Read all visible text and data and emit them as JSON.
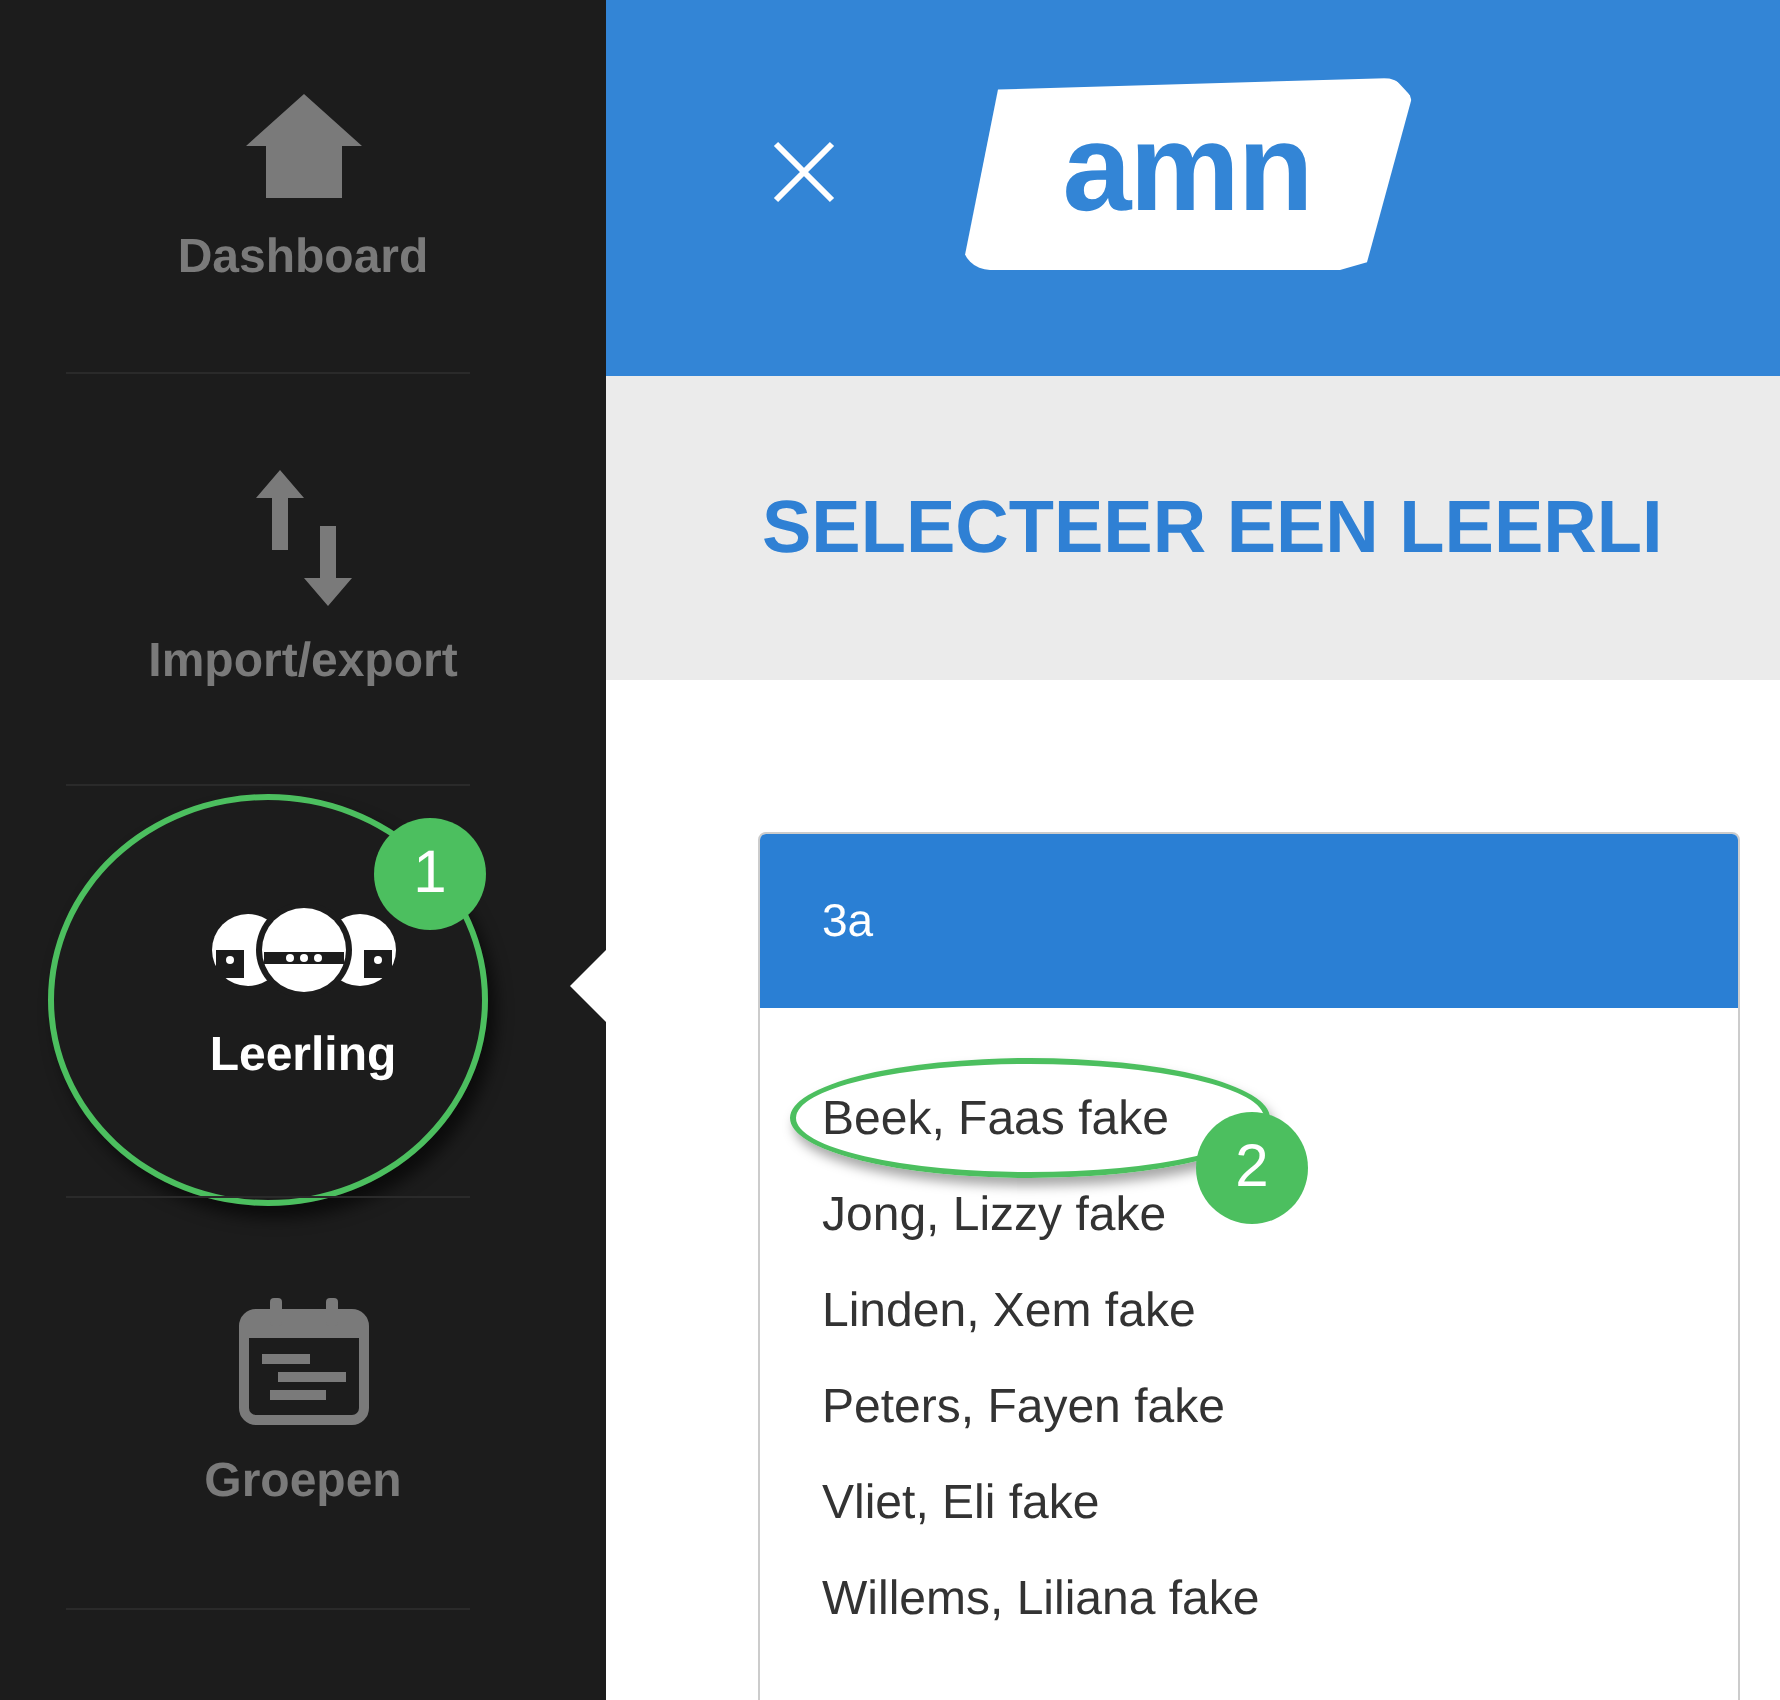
{
  "sidebar": {
    "items": [
      {
        "label": "Dashboard",
        "selected": false
      },
      {
        "label": "Import/export",
        "selected": false
      },
      {
        "label": "Leerling",
        "selected": true,
        "callout": "1"
      },
      {
        "label": "Groepen",
        "selected": false
      }
    ]
  },
  "header": {
    "logo": "amn"
  },
  "page_title": "SELECTEER EEN LEERLI",
  "group": {
    "title": "3a",
    "students": [
      {
        "name": "Beek, Faas fake",
        "callout": "2"
      },
      {
        "name": "Jong, Lizzy fake"
      },
      {
        "name": "Linden, Xem fake"
      },
      {
        "name": "Peters, Fayen fake"
      },
      {
        "name": "Vliet, Eli fake"
      },
      {
        "name": "Willems, Liliana fake"
      }
    ]
  }
}
